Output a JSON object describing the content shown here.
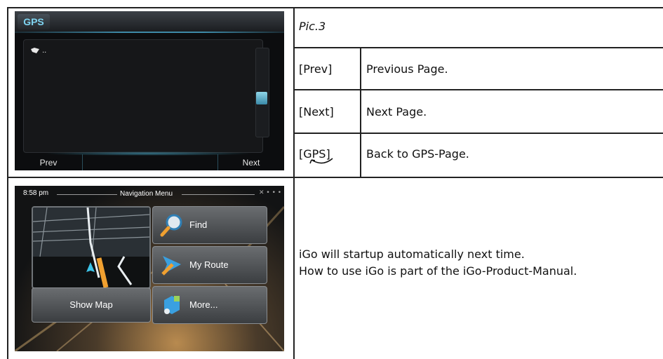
{
  "table": {
    "pic_label": "Pic.3",
    "rows": [
      {
        "key": "[Prev]",
        "desc": "Previous Page."
      },
      {
        "key": "[Next]",
        "desc": "Next Page."
      },
      {
        "key": "[GPS]",
        "desc": "Back to GPS-Page."
      }
    ],
    "igo_text": [
      "iGo will startup automatically next time.",
      "How to use iGo is part of the iGo-Product-Manual."
    ]
  },
  "gps_screen": {
    "tab_label": "GPS",
    "list_item": "..",
    "prev_label": "Prev",
    "next_label": "Next",
    "accent": "#7fd4f0"
  },
  "nav_screen": {
    "time": "8:58 pm",
    "title": "Navigation Menu",
    "show_map_label": "Show Map",
    "find_label": "Find",
    "my_route_label": "My Route",
    "more_label": "More..."
  },
  "gps_key_icon": "return-arrow-icon"
}
